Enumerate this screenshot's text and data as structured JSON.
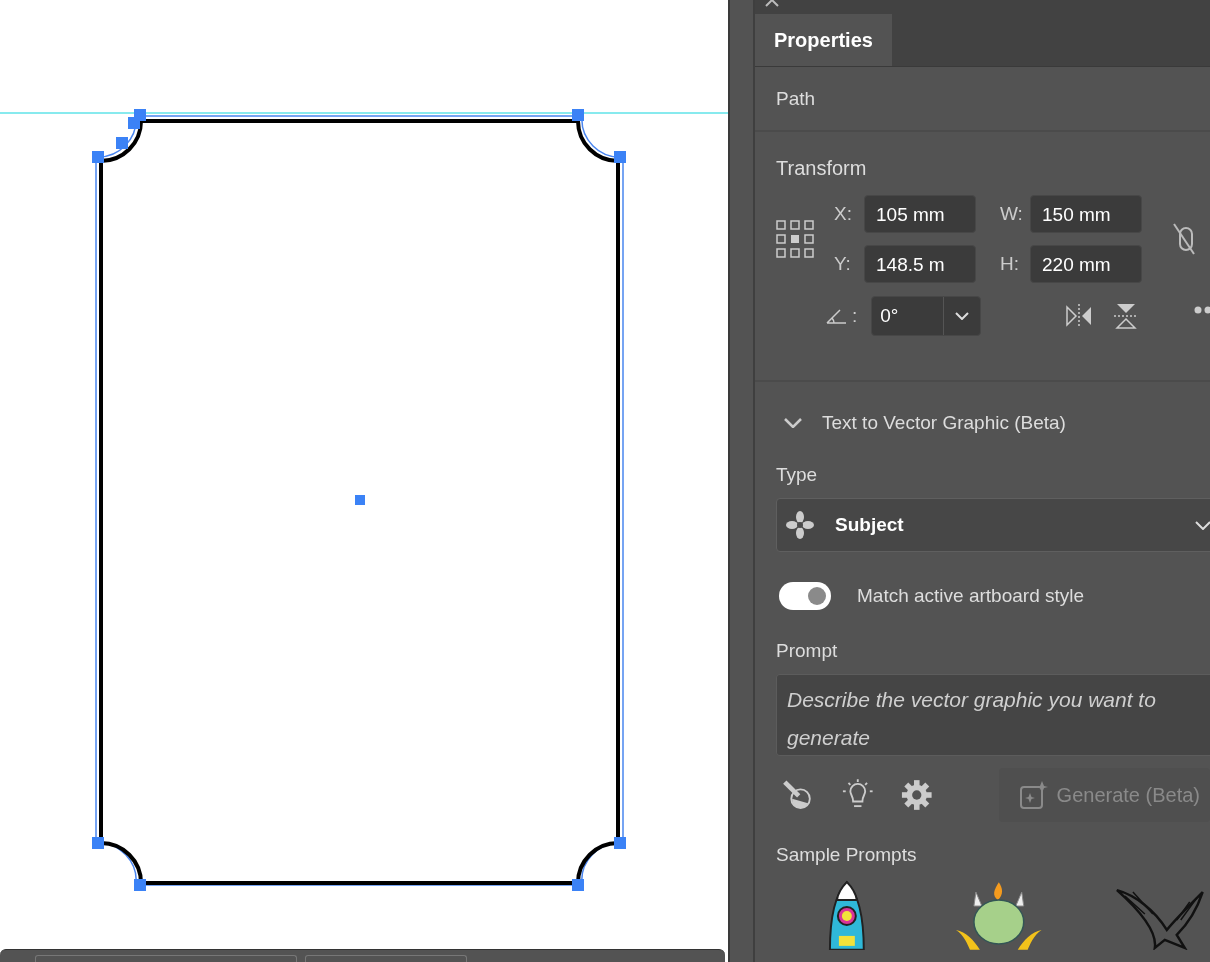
{
  "panel": {
    "tabs": [
      {
        "label": "Properties",
        "selected": true
      }
    ],
    "section": "Path",
    "transform": {
      "title": "Transform",
      "x_label": "X:",
      "x": "105 mm",
      "y_label": "Y:",
      "y": "148.5 m",
      "w_label": "W:",
      "w": "150 mm",
      "h_label": "H:",
      "h": "220 mm",
      "angle_label": ":",
      "angle": "0°"
    },
    "t2v": {
      "title": "Text to Vector Graphic (Beta)",
      "expanded": true,
      "type_label": "Type",
      "type": "Subject",
      "toggle": {
        "label": "Match active artboard style",
        "on": true
      },
      "prompt_label": "Prompt",
      "prompt_placeholder": "Describe the vector graphic you want to generate",
      "generate": {
        "label": "Generate (Beta)",
        "disabled": true
      },
      "samples_title": "Sample Prompts"
    }
  }
}
